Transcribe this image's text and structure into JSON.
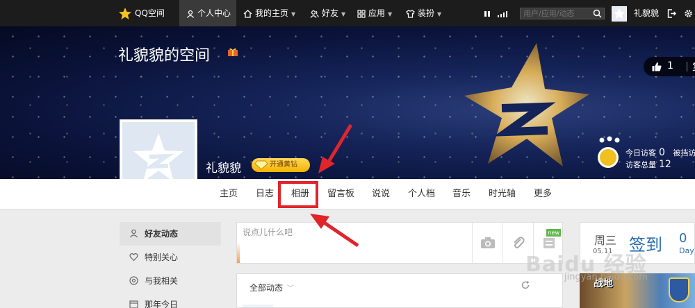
{
  "topbar": {
    "logo": "QQ空间",
    "items": [
      {
        "label": "个人中心"
      },
      {
        "label": "我的主页"
      },
      {
        "label": "好友"
      },
      {
        "label": "应用"
      },
      {
        "label": "装扮"
      }
    ],
    "search_placeholder": "用户/应用/动态",
    "user_name": "礼貌貌"
  },
  "banner": {
    "space_title": "礼貌貌的空间",
    "like_count": "1",
    "like_more": "赏",
    "username": "礼貌貌",
    "yellow_diamond": "开通黄钻",
    "visitors": {
      "today_label": "今日访客",
      "today_value": "0",
      "today_extra": "被挡访",
      "total_label": "访客总量",
      "total_value": "12"
    }
  },
  "nav": {
    "items": [
      {
        "label": "主页"
      },
      {
        "label": "日志"
      },
      {
        "label": "相册"
      },
      {
        "label": "留言板"
      },
      {
        "label": "说说"
      },
      {
        "label": "个人档"
      },
      {
        "label": "音乐"
      },
      {
        "label": "时光轴"
      },
      {
        "label": "更多"
      }
    ],
    "highlighted": "相册"
  },
  "sidebar": {
    "items": [
      {
        "label": "好友动态"
      },
      {
        "label": "特别关心"
      },
      {
        "label": "与我相关"
      },
      {
        "label": "那年今日"
      }
    ]
  },
  "post": {
    "placeholder": "说点儿什么吧",
    "new_tag": "new"
  },
  "feed": {
    "title": "全部动态"
  },
  "sign_card": {
    "weekday": "周三",
    "date": "05.11",
    "sign_label": "签到",
    "days_value": "0",
    "days_label": "Day"
  },
  "ad": {
    "title": "战地"
  },
  "watermark": {
    "brand": "Baidu 经验",
    "url": "jingyan.baidu.com"
  },
  "colors": {
    "topbar": "#1c1c1c",
    "highlight_red": "#e0252b",
    "yellow_diamond": "#f4b400",
    "link_blue": "#2a6fb0"
  }
}
